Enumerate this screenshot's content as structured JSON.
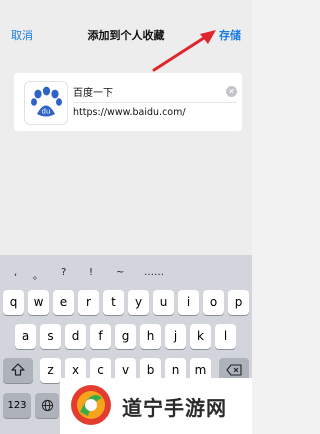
{
  "nav": {
    "cancel": "取消",
    "title": "添加到个人收藏",
    "save": "存储"
  },
  "bookmark": {
    "title_value": "百度一下",
    "url_value": "https://www.baidu.com/",
    "thumbnail_icon": "baidu-paw-logo"
  },
  "keyboard": {
    "candidates": [
      ",",
      "。",
      "?",
      "!",
      "~",
      "……"
    ],
    "row1": [
      "q",
      "w",
      "e",
      "r",
      "t",
      "y",
      "u",
      "i",
      "o",
      "p"
    ],
    "row2": [
      "a",
      "s",
      "d",
      "f",
      "g",
      "h",
      "j",
      "k",
      "l"
    ],
    "row3": [
      "z",
      "x",
      "c",
      "v",
      "b",
      "n",
      "m"
    ],
    "num_key": "123"
  },
  "watermark": {
    "text": "道宁手游网"
  },
  "colors": {
    "accent": "#1a7ddf",
    "arrow": "#e0262d",
    "baidu_blue": "#2f63c6"
  }
}
